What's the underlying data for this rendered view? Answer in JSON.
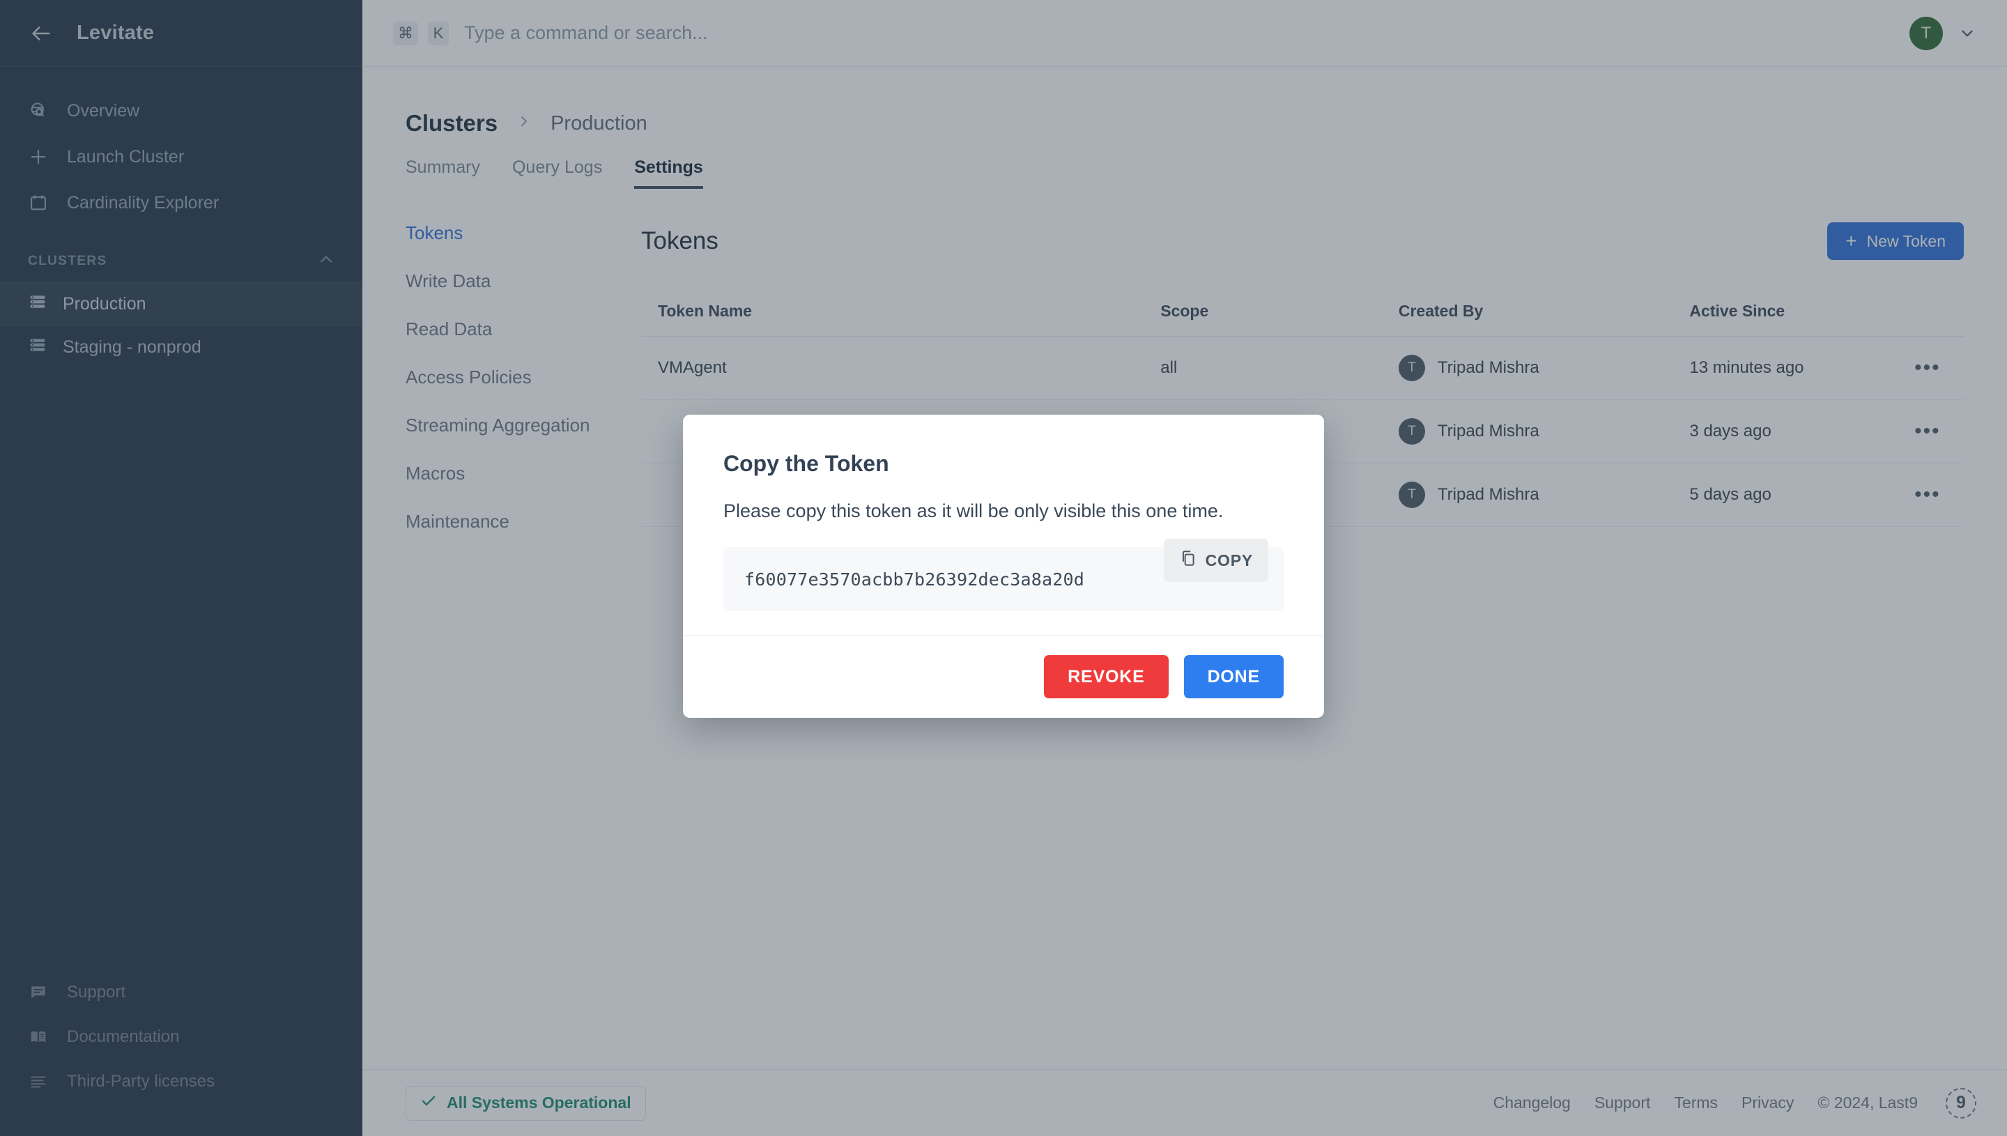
{
  "sidebar": {
    "brand": "Levitate",
    "back_icon": "arrow-left-icon",
    "nav": [
      {
        "label": "Overview",
        "icon": "globe-search-icon"
      },
      {
        "label": "Launch Cluster",
        "icon": "plus-icon"
      },
      {
        "label": "Cardinality Explorer",
        "icon": "calendar-icon"
      }
    ],
    "clusters_section": {
      "label": "CLUSTERS",
      "collapse_icon": "chevron-up-icon"
    },
    "clusters": [
      {
        "label": "Production",
        "icon": "server-icon",
        "active": true
      },
      {
        "label": "Staging - nonprod",
        "icon": "server-icon",
        "active": false
      }
    ],
    "footer_nav": [
      {
        "label": "Support",
        "icon": "chat-icon"
      },
      {
        "label": "Documentation",
        "icon": "book-icon"
      },
      {
        "label": "Third-Party licenses",
        "icon": "lines-icon"
      }
    ]
  },
  "topbar": {
    "kbd_modifier": "⌘",
    "kbd_key": "K",
    "search_placeholder": "Type a command or search...",
    "search_value": "",
    "avatar_initial": "T",
    "avatar_color": "#2f6a32",
    "chevron_icon": "chevron-down-icon"
  },
  "breadcrumb": {
    "root": "Clusters",
    "separator": "›",
    "leaf": "Production"
  },
  "tabs": [
    {
      "label": "Summary",
      "active": false
    },
    {
      "label": "Query Logs",
      "active": false
    },
    {
      "label": "Settings",
      "active": true
    }
  ],
  "settings_nav": [
    {
      "label": "Tokens",
      "active": true
    },
    {
      "label": "Write Data",
      "active": false
    },
    {
      "label": "Read Data",
      "active": false
    },
    {
      "label": "Access Policies",
      "active": false
    },
    {
      "label": "Streaming Aggregation",
      "active": false
    },
    {
      "label": "Macros",
      "active": false
    },
    {
      "label": "Maintenance",
      "active": false
    }
  ],
  "panel": {
    "title": "Tokens",
    "new_token_button": "New Token",
    "new_token_plus": "+",
    "accent_color": "#2f6fd8"
  },
  "table": {
    "columns": [
      "Token Name",
      "Scope",
      "Created By",
      "Active Since",
      ""
    ],
    "rows": [
      {
        "name": "VMAgent",
        "scope": "all",
        "created_by": "Tripad Mishra",
        "created_by_initial": "T",
        "active_since": "13 minutes ago",
        "actions_icon": "ellipsis-icon",
        "obscured": false
      },
      {
        "name": "",
        "scope": "",
        "created_by": "Tripad Mishra",
        "created_by_initial": "T",
        "active_since": "3 days ago",
        "actions_icon": "ellipsis-icon",
        "obscured": true
      },
      {
        "name": "",
        "scope": "",
        "created_by": "Tripad Mishra",
        "created_by_initial": "T",
        "active_since": "5 days ago",
        "actions_icon": "ellipsis-icon",
        "obscured": true
      }
    ]
  },
  "modal": {
    "title": "Copy the Token",
    "description": "Please copy this token as it will be only visible this one time.",
    "token_value": "f60077e3570acbb7b26392dec3a8a20d",
    "copy_label": "COPY",
    "copy_icon": "copy-icon",
    "revoke_label": "REVOKE",
    "done_label": "DONE",
    "revoke_color": "#ef3b3b",
    "done_color": "#2f7ef0"
  },
  "footer": {
    "status": "All Systems Operational",
    "status_icon": "check-icon",
    "status_color": "#1c8c6a",
    "links": [
      "Changelog",
      "Support",
      "Terms",
      "Privacy"
    ],
    "copyright": "© 2024, Last9",
    "logo_text": "9"
  }
}
